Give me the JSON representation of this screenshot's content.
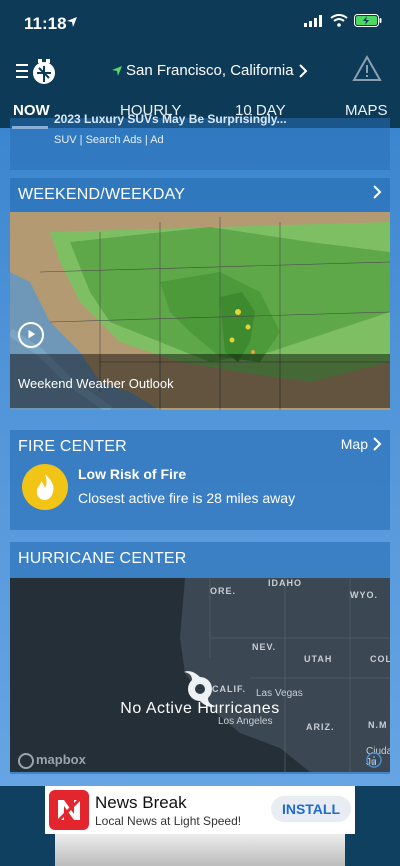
{
  "status": {
    "time": "11:18"
  },
  "appbar": {
    "location": "San Francisco, California"
  },
  "tabs": [
    {
      "label": "NOW"
    },
    {
      "label": "HOURLY"
    },
    {
      "label": "10 DAY"
    },
    {
      "label": "MAPS"
    }
  ],
  "ad_top": {
    "headline": "2023 Luxury SUVs May Be Surprisingly...",
    "source": "SUV | Search Ads | Ad"
  },
  "weekend": {
    "title": "WEEKEND/WEEKDAY",
    "caption": "Weekend Weather Outlook"
  },
  "fire": {
    "title": "FIRE CENTER",
    "map_link": "Map",
    "risk": "Low Risk of Fire",
    "detail": "Closest active fire is 28 miles away"
  },
  "hurricane": {
    "title": "HURRICANE CENTER",
    "status": "No Active Hurricanes",
    "attribution": "mapbox",
    "labels": [
      "ORE.",
      "IDAHO",
      "WYO.",
      "NEV.",
      "UTAH",
      "COL",
      "CALIF.",
      "Las Vegas",
      "Los Angeles",
      "ARIZ.",
      "N.M",
      "Ciudad Ju"
    ]
  },
  "bottom_ad": {
    "title": "News Break",
    "subtitle": "Local News at Light Speed!",
    "cta": "INSTALL"
  },
  "colors": {
    "header": "#0d3a57",
    "fire_icon": "#f2c416",
    "news_break": "#e3262d",
    "install_text": "#1f69d2"
  }
}
